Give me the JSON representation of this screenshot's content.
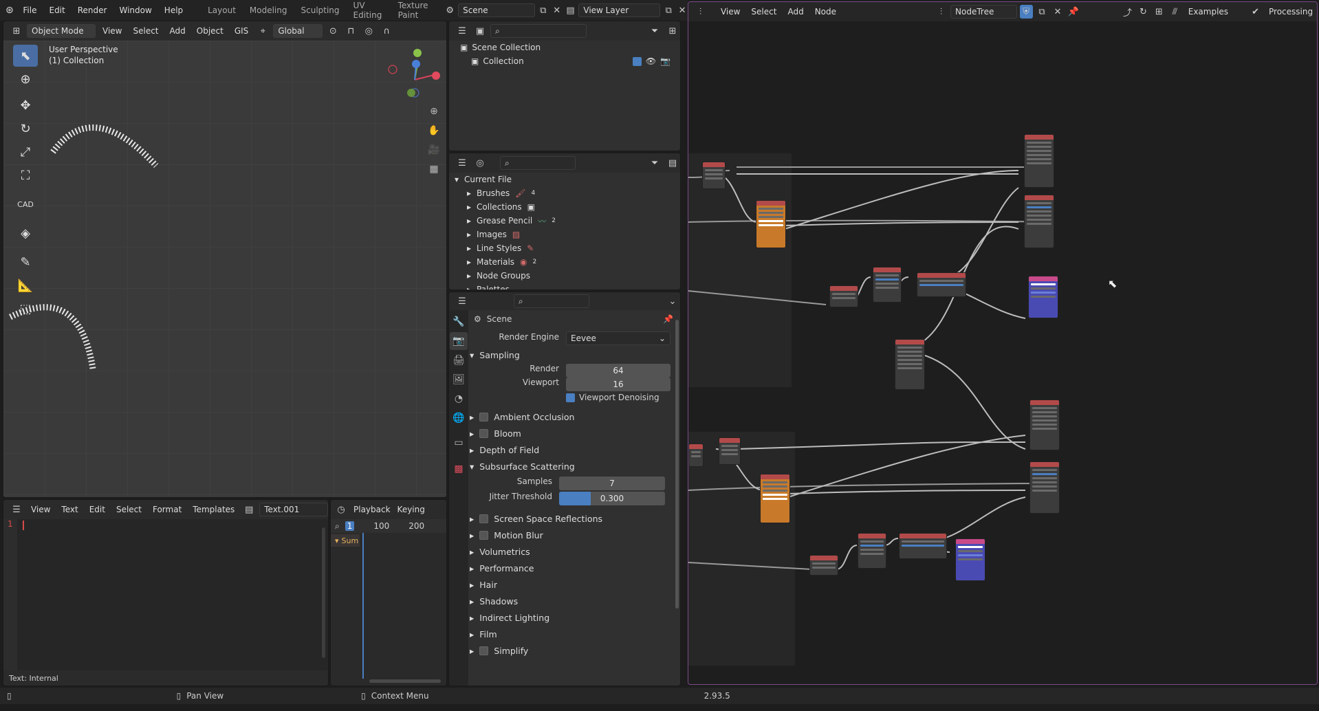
{
  "topbar": {
    "menus": [
      "File",
      "Edit",
      "Render",
      "Window",
      "Help"
    ],
    "workspaces": [
      "Layout",
      "Modeling",
      "Sculpting",
      "UV Editing",
      "Texture Paint"
    ],
    "scene": "Scene",
    "view_layer": "View Layer"
  },
  "viewport": {
    "mode": "Object Mode",
    "menus": [
      "View",
      "Select",
      "Add",
      "Object",
      "GIS"
    ],
    "orientation": "Global",
    "overlay_title": "User Perspective",
    "overlay_subtitle": "(1) Collection",
    "cad_label": "CAD"
  },
  "outliner": {
    "rows": [
      "Scene Collection",
      "Collection"
    ]
  },
  "blendfile": {
    "root": "Current File",
    "items": [
      "Brushes",
      "Collections",
      "Grease Pencil",
      "Images",
      "Line Styles",
      "Materials",
      "Node Groups",
      "Palettes"
    ],
    "badges": [
      "4",
      "",
      "2",
      "",
      "",
      "2",
      "",
      ""
    ]
  },
  "properties": {
    "scene_label": "Scene",
    "render_engine_label": "Render Engine",
    "render_engine_value": "Eevee",
    "sampling": "Sampling",
    "render_label": "Render",
    "render_value": "64",
    "viewport_label": "Viewport",
    "viewport_value": "16",
    "denoise": "Viewport Denoising",
    "panels_a": [
      "Ambient Occlusion",
      "Bloom",
      "Depth of Field"
    ],
    "sss": "Subsurface Scattering",
    "samples_label": "Samples",
    "samples_value": "7",
    "jitter_label": "Jitter Threshold",
    "jitter_value": "0.300",
    "jitter_fraction": 0.3,
    "panels_b": [
      "Screen Space Reflections",
      "Motion Blur",
      "Volumetrics",
      "Performance",
      "Hair",
      "Shadows",
      "Indirect Lighting",
      "Film",
      "Simplify"
    ]
  },
  "text_editor": {
    "menus": [
      "View",
      "Text",
      "Edit",
      "Select",
      "Format",
      "Templates"
    ],
    "file": "Text.001",
    "line_no": "1",
    "footer": "Text: Internal"
  },
  "timeline": {
    "menus": [
      "Playback",
      "Keying"
    ],
    "frame": "1",
    "ticks": [
      "100",
      "200"
    ],
    "track": "Sum"
  },
  "node_editor": {
    "menus": [
      "View",
      "Select",
      "Add",
      "Node"
    ],
    "tree": "NodeTree",
    "examples": "Examples",
    "processing": "Processing"
  },
  "statusbar": {
    "pan": "Pan View",
    "context": "Context Menu",
    "version": "2.93.5"
  }
}
